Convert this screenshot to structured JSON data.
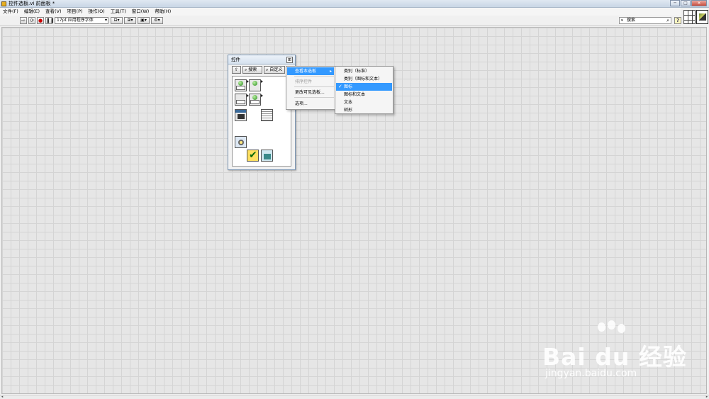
{
  "window": {
    "title": "控件选板.vi 前面板 *",
    "buttons": {
      "minimize": "─",
      "maximize": "□",
      "close": "✕"
    }
  },
  "menubar": {
    "items": [
      "文件(F)",
      "编辑(E)",
      "查看(V)",
      "项目(P)",
      "操作(O)",
      "工具(T)",
      "窗口(W)",
      "帮助(H)"
    ]
  },
  "toolbar": {
    "font_label": "17pt 应用程序字体",
    "search_placeholder": "搜索",
    "help_label": "?"
  },
  "palette": {
    "title": "控件",
    "up_label": "⇧",
    "search_label": "搜索",
    "customize_label": "自定义"
  },
  "context_menu": {
    "items": [
      {
        "label": "查看本选板",
        "highlighted": true,
        "submenu": true
      },
      {
        "label": "排序控件",
        "disabled": true
      },
      {
        "label": "更改可见选板...",
        "disabled": false
      },
      {
        "label": "选项...",
        "disabled": false
      }
    ]
  },
  "view_submenu": {
    "items": [
      {
        "label": "类别（标准）",
        "checked": false
      },
      {
        "label": "类别（图标和文本）",
        "checked": false
      },
      {
        "label": "图标",
        "checked": true
      },
      {
        "label": "图标和文本",
        "checked": false
      },
      {
        "label": "文本",
        "checked": false
      },
      {
        "label": "树形",
        "checked": false
      }
    ]
  },
  "watermark": {
    "brand": "Bai du 经验",
    "url": "jingyan.baidu.com"
  },
  "colors": {
    "highlight": "#3399ff",
    "grid_bg": "#e6e6e6",
    "grid_line": "#d4d4d4"
  }
}
